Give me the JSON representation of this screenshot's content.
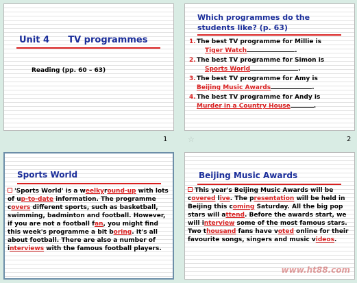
{
  "slide1": {
    "title_unit": "Unit 4",
    "title_topic": "TV programmes",
    "subtitle": "Reading (pp. 60 – 63)",
    "number": "1"
  },
  "slide2": {
    "title": "Which programmes do the students like? (p. 63)",
    "number": "2",
    "items": [
      {
        "num": "1.",
        "question": "The best TV programme for Millie is",
        "answer": "Tiger Watch"
      },
      {
        "num": "2.",
        "question": "The best TV programme for Simon is",
        "answer": "Sports World"
      },
      {
        "num": "3.",
        "question": "The best TV programme for Amy is",
        "answer": "Beijing Music Awards"
      },
      {
        "num": "4.",
        "question": "The best TV programme for Andy is",
        "answer": "Murder in a Country House"
      }
    ]
  },
  "slide3": {
    "title": "Sports World",
    "segments": [
      {
        "t": "'Sports World' is a w",
        "a": false
      },
      {
        "t": "eelky",
        "a": true
      },
      {
        "t": "r",
        "a": false
      },
      {
        "t": "ound-up",
        "a": true
      },
      {
        "t": " with lots of u",
        "a": false
      },
      {
        "t": "p-to-date",
        "a": true
      },
      {
        "t": " information. The programme c",
        "a": false
      },
      {
        "t": "overs",
        "a": true
      },
      {
        "t": " different sports, such as basketball, swimming, badminton and football. However, if you are not a football f",
        "a": false
      },
      {
        "t": "an",
        "a": true
      },
      {
        "t": ", you might find this week's programme a bit b",
        "a": false
      },
      {
        "t": "oring",
        "a": true
      },
      {
        "t": ". It's all about football. There are also a number of i",
        "a": false
      },
      {
        "t": "nterviews",
        "a": true
      },
      {
        "t": " with the famous football players.",
        "a": false
      }
    ]
  },
  "slide4": {
    "title": "Beijing Music Awards",
    "segments": [
      {
        "t": "This year's Beijing Music Awards will be c",
        "a": false
      },
      {
        "t": "overed",
        "a": true
      },
      {
        "t": " l",
        "a": false
      },
      {
        "t": "ive",
        "a": true
      },
      {
        "t": ". The p",
        "a": false
      },
      {
        "t": "resentation",
        "a": true
      },
      {
        "t": " will be held in Beijing this c",
        "a": false
      },
      {
        "t": "oming",
        "a": true
      },
      {
        "t": " Saturday. All the big pop stars will a",
        "a": false
      },
      {
        "t": "ttend",
        "a": true
      },
      {
        "t": ". Before the awards start, we will i",
        "a": false
      },
      {
        "t": "nterview",
        "a": true
      },
      {
        "t": " some of the most famous stars. Two t",
        "a": false
      },
      {
        "t": "housand",
        "a": true
      },
      {
        "t": " fans have v",
        "a": false
      },
      {
        "t": "oted",
        "a": true
      },
      {
        "t": " online for their favourite songs, singers and music v",
        "a": false
      },
      {
        "t": "ideos",
        "a": true
      },
      {
        "t": ".",
        "a": false
      }
    ]
  },
  "watermark": "www.ht88.com",
  "colors": {
    "title_blue": "#1b2e9a",
    "answer_red": "#d92020",
    "background": "#d9ece4",
    "selected_border": "#6c8ea8"
  }
}
